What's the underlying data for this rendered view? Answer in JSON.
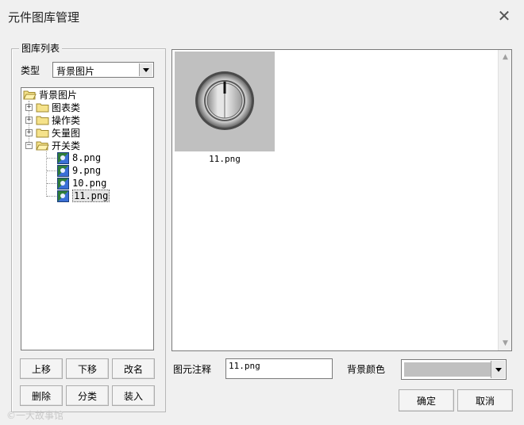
{
  "window": {
    "title": "元件图库管理",
    "close_glyph": "✕"
  },
  "library": {
    "group_label": "图库列表",
    "type_label": "类型",
    "type_value": "背景图片",
    "tree": {
      "root": "背景图片",
      "folders": [
        "图表类",
        "操作类",
        "矢量图",
        "开关类"
      ],
      "files": [
        "8.png",
        "9.png",
        "10.png",
        "11.png"
      ],
      "selected": "11.png"
    },
    "buttons": {
      "move_up": "上移",
      "move_down": "下移",
      "rename": "改名",
      "delete": "删除",
      "classify": "分类",
      "load": "装入"
    }
  },
  "preview": {
    "items": [
      {
        "label": "11.png",
        "icon": "knob-switch-icon",
        "bg": "#c0c0c0"
      }
    ]
  },
  "footer": {
    "note_label": "图元注释",
    "note_value": "11.png",
    "bg_color_label": "背景颜色",
    "bg_color_value": "#c0c0c0",
    "ok": "确定",
    "cancel": "取消"
  },
  "watermark": "©一大故事馆"
}
